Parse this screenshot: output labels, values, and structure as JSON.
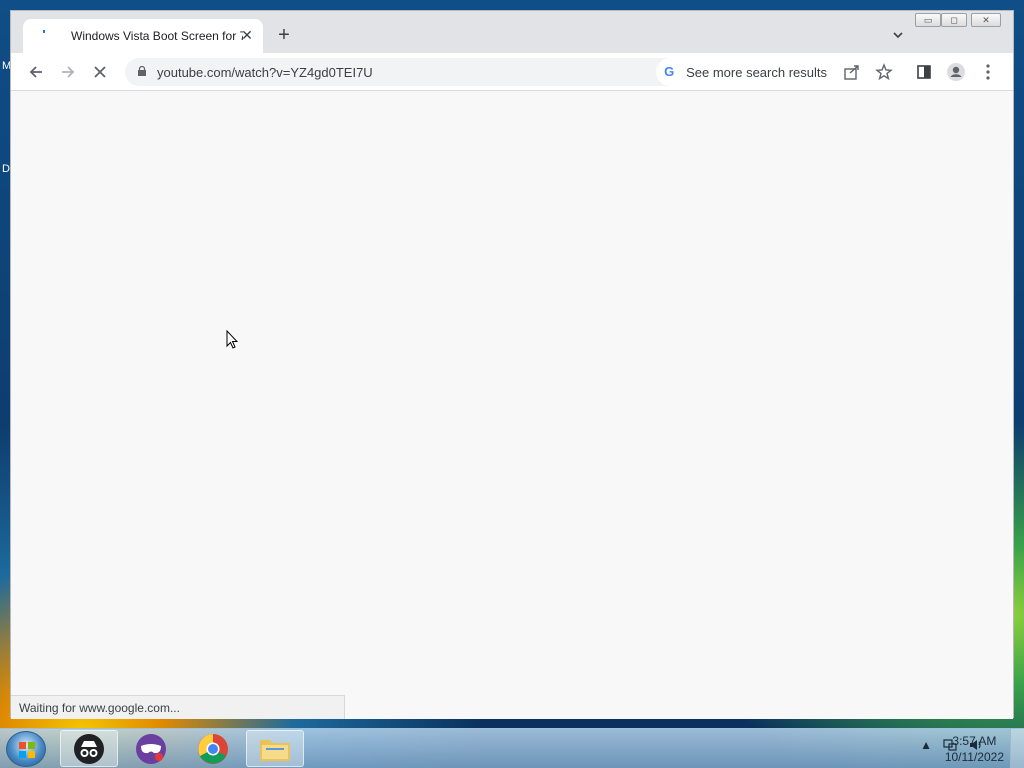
{
  "desktop": {
    "left_labels": [
      "M",
      "D"
    ]
  },
  "browser": {
    "tab": {
      "title": "Windows Vista Boot Screen for 7"
    },
    "new_tab_label": "+",
    "window_controls": {
      "minimize": "▭",
      "maximize": "◻",
      "close": "✕"
    },
    "address": {
      "url": "youtube.com/watch?v=YZ4gd0TEI7U"
    },
    "see_more": "See more search results",
    "status": "Waiting for www.google.com..."
  },
  "taskbar": {
    "time": "3:57 AM",
    "date": "10/11/2022",
    "apps": [
      "incognito-app",
      "mask-app",
      "chrome-app",
      "explorer-app"
    ]
  }
}
